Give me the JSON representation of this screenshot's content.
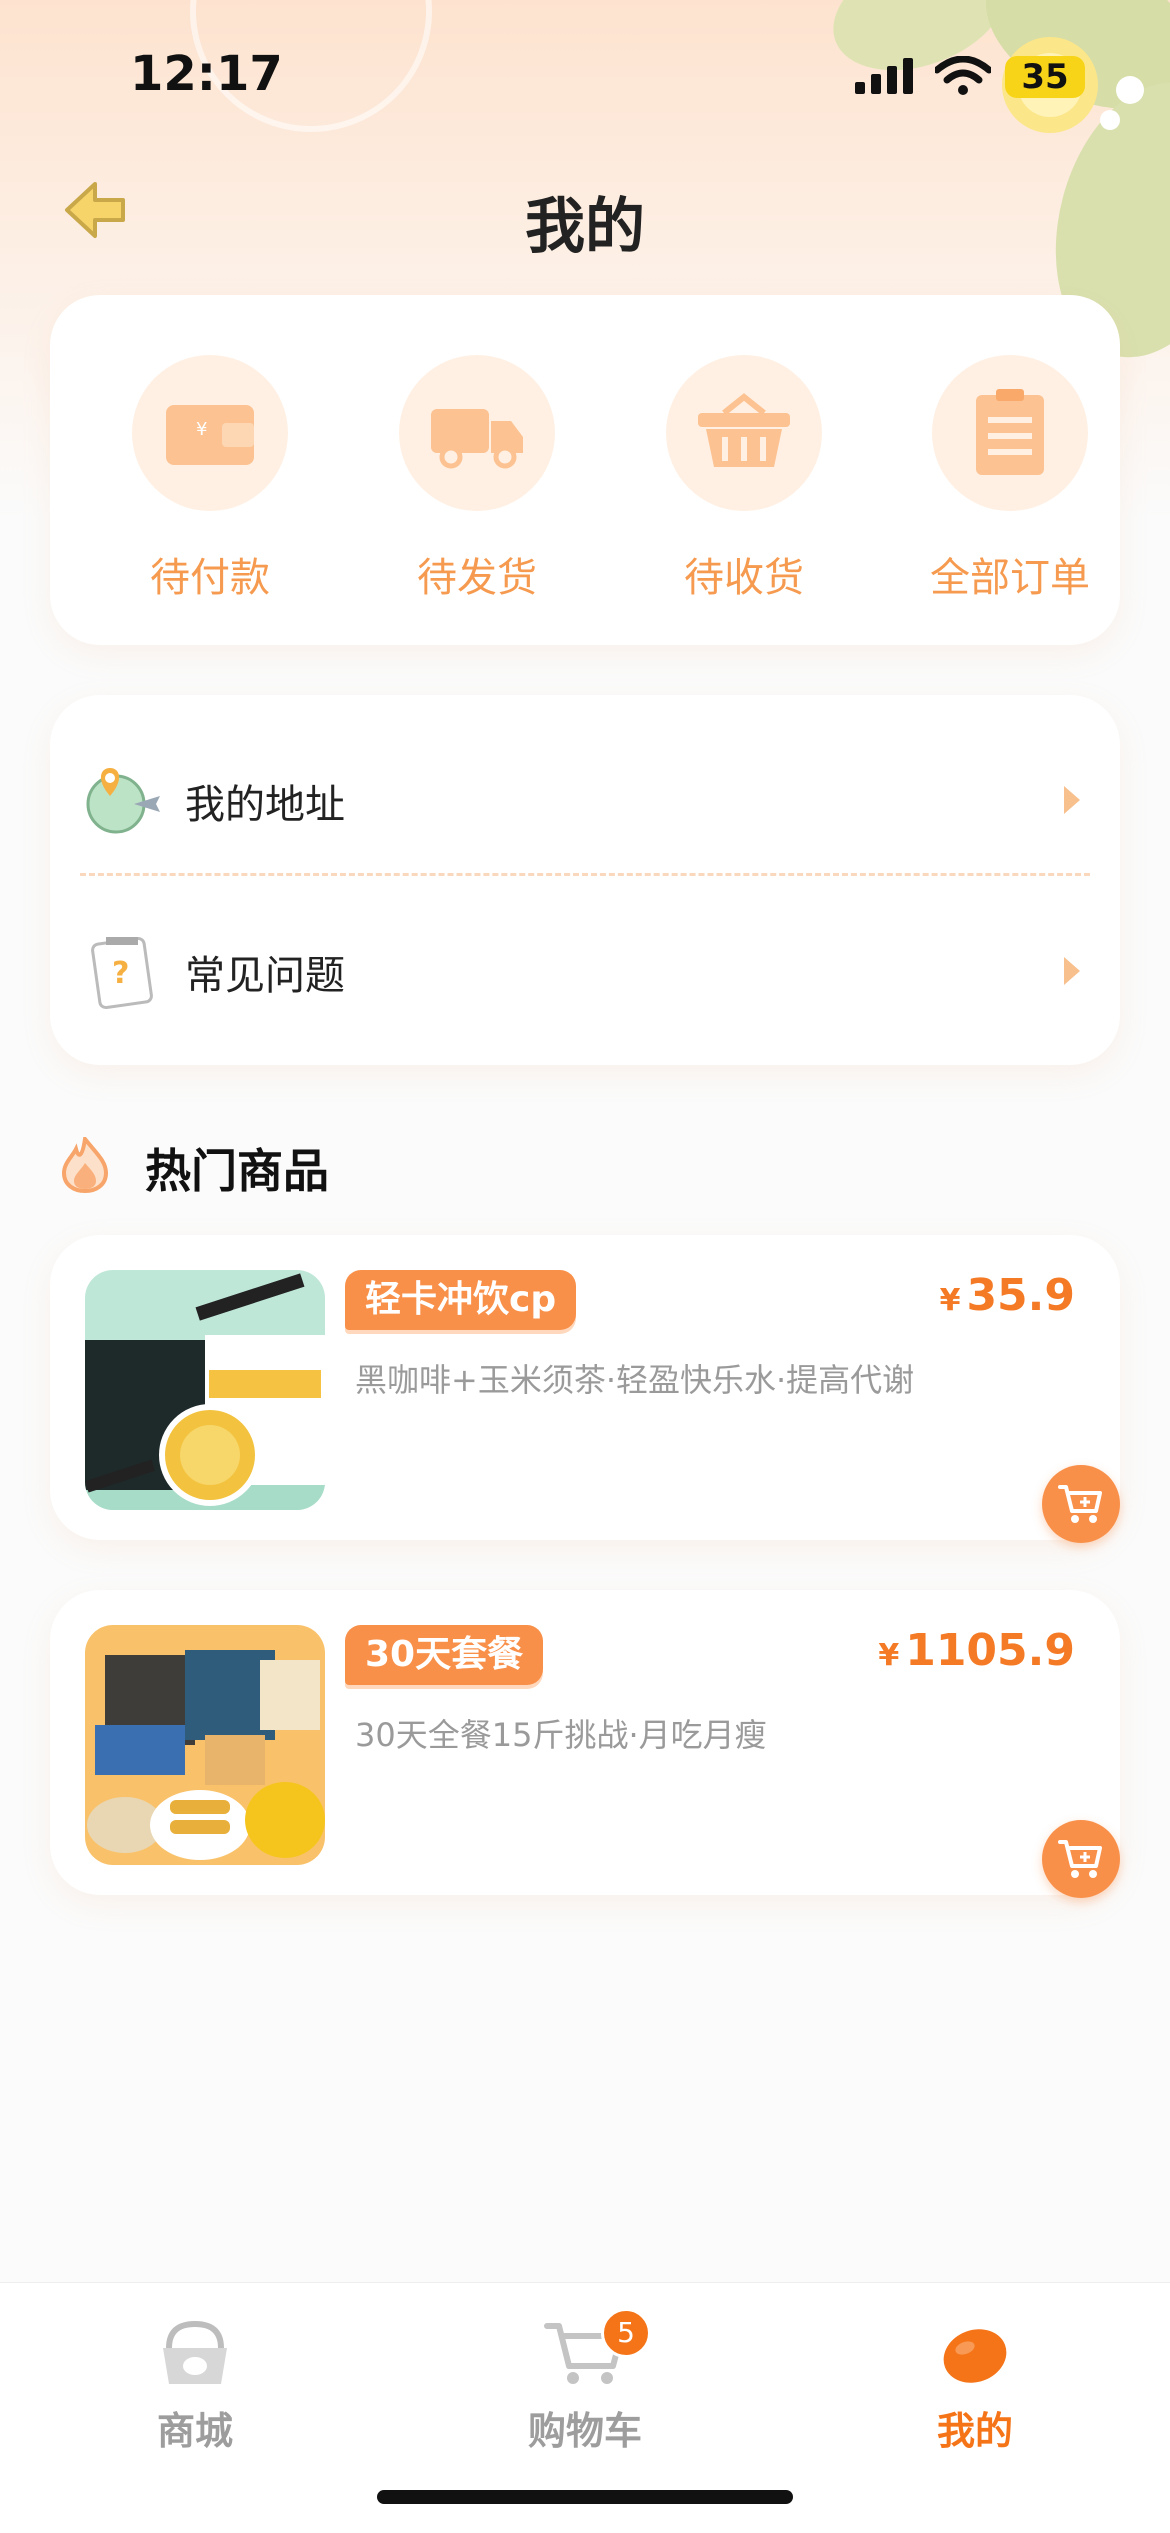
{
  "status_bar": {
    "time": "12:17",
    "battery": "35"
  },
  "header": {
    "title": "我的"
  },
  "orders": [
    {
      "label": "待付款",
      "icon": "wallet-icon"
    },
    {
      "label": "待发货",
      "icon": "truck-icon"
    },
    {
      "label": "待收货",
      "icon": "basket-icon"
    },
    {
      "label": "全部订单",
      "icon": "clipboard-icon"
    }
  ],
  "menu": [
    {
      "label": "我的地址",
      "icon": "globe-plane-icon"
    },
    {
      "label": "常见问题",
      "icon": "question-notebook-icon"
    }
  ],
  "hot": {
    "title": "热门商品"
  },
  "products": [
    {
      "tag": "轻卡冲饮cp",
      "price_symbol": "¥",
      "price": "35.9",
      "desc": "黑咖啡+玉米须茶·轻盈快乐水·提高代谢"
    },
    {
      "tag": "30天套餐",
      "price_symbol": "¥",
      "price": "1105.9",
      "desc": "30天全餐15斤挑战·月吃月瘦"
    }
  ],
  "tabbar": {
    "tabs": [
      {
        "label": "商城",
        "icon": "bag-icon"
      },
      {
        "label": "购物车",
        "icon": "cart-icon",
        "badge": "5"
      },
      {
        "label": "我的",
        "icon": "lemon-icon"
      }
    ]
  },
  "colors": {
    "accent": "#f57418",
    "light_accent": "#f9904a",
    "icon_bg": "#fff0e3"
  }
}
